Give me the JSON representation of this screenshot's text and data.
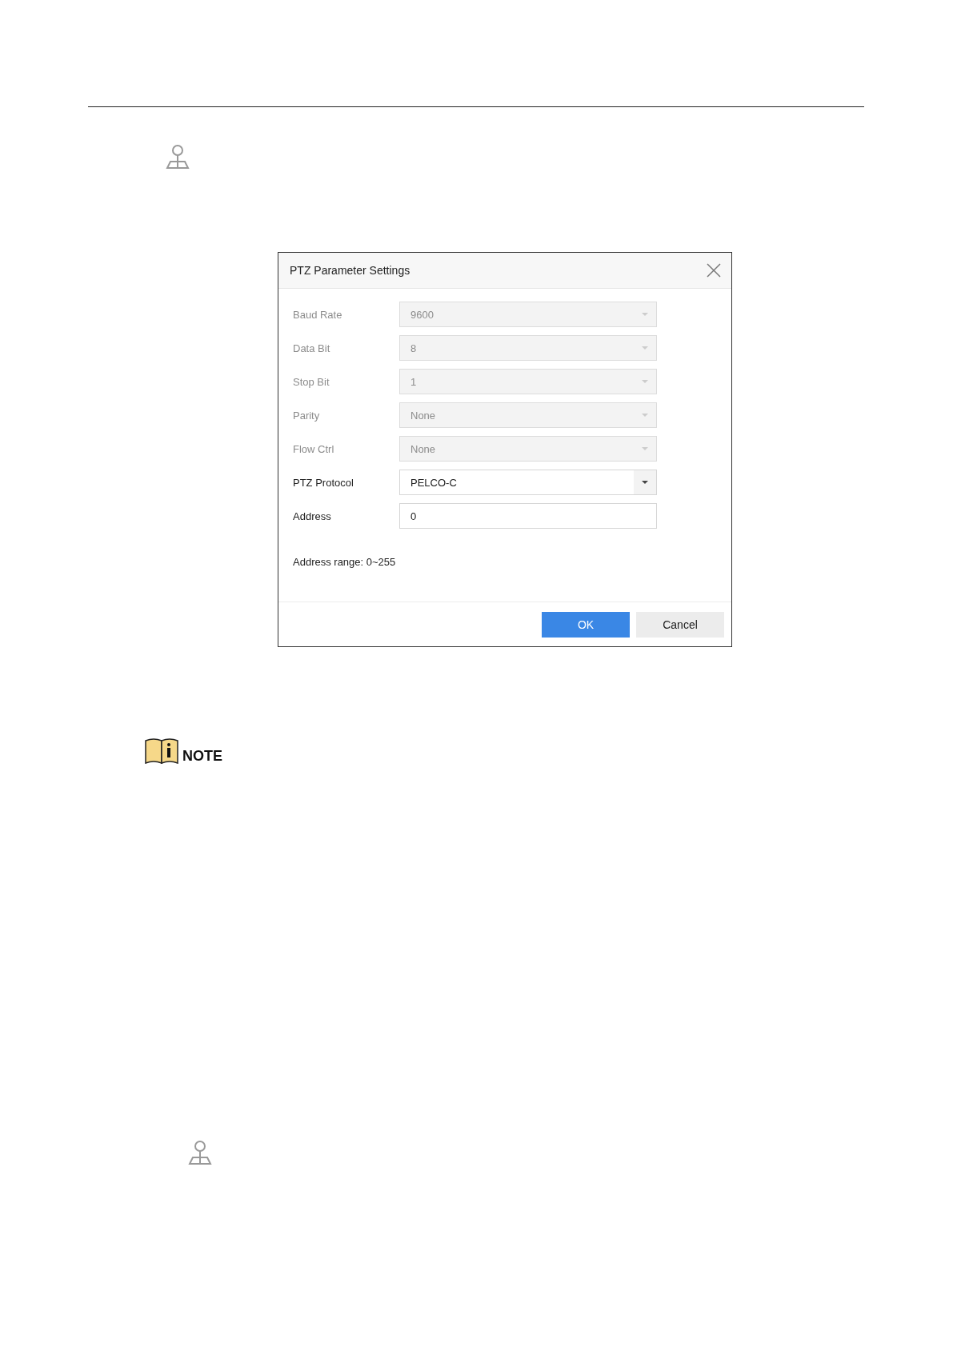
{
  "dialog": {
    "title": "PTZ Parameter Settings",
    "fields": [
      {
        "label": "Baud Rate",
        "value": "9600",
        "kind": "select",
        "disabled": true
      },
      {
        "label": "Data Bit",
        "value": "8",
        "kind": "select",
        "disabled": true
      },
      {
        "label": "Stop Bit",
        "value": "1",
        "kind": "select",
        "disabled": true
      },
      {
        "label": "Parity",
        "value": "None",
        "kind": "select",
        "disabled": true
      },
      {
        "label": "Flow Ctrl",
        "value": "None",
        "kind": "select",
        "disabled": true
      },
      {
        "label": "PTZ Protocol",
        "value": "PELCO-C",
        "kind": "select",
        "disabled": false
      },
      {
        "label": "Address",
        "value": "0",
        "kind": "text",
        "disabled": false
      }
    ],
    "hint": "Address range: 0~255",
    "buttons": [
      {
        "label": "OK",
        "kind": "primary"
      },
      {
        "label": "Cancel",
        "kind": "secondary"
      }
    ]
  },
  "note": {
    "label": "NOTE"
  }
}
